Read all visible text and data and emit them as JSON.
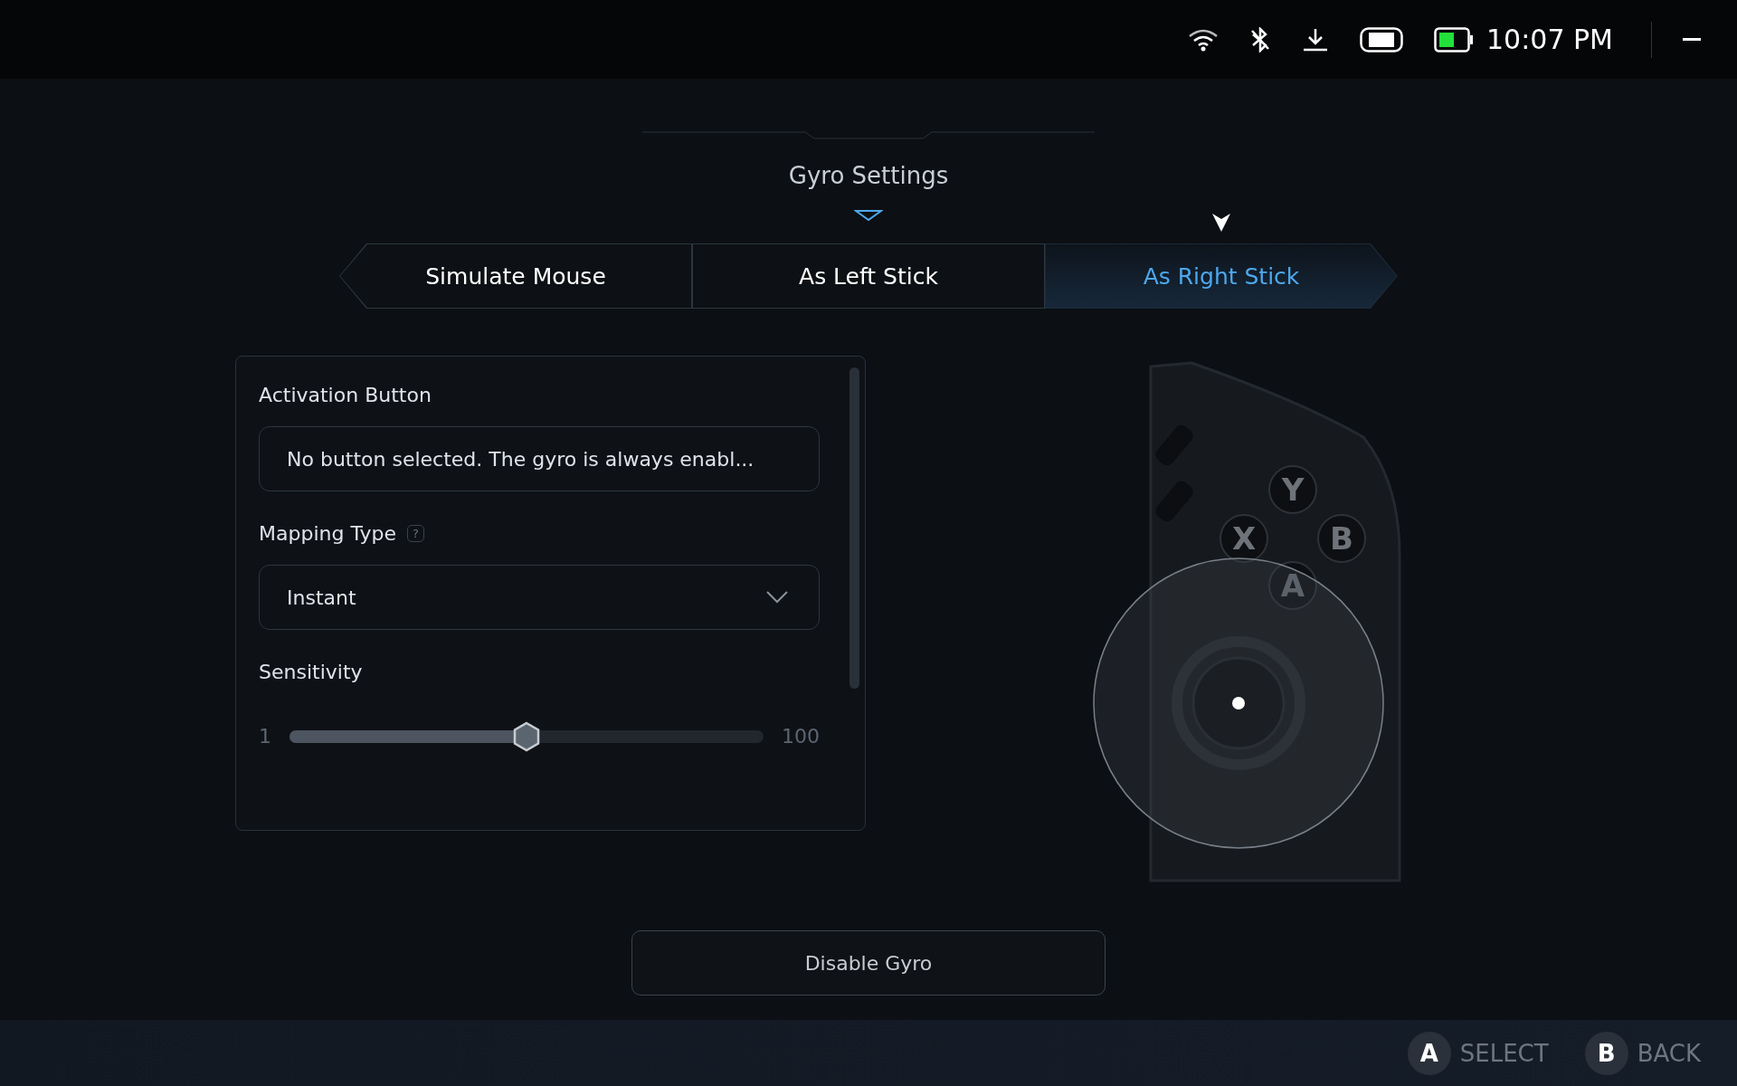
{
  "status_bar": {
    "time": "10:07 PM"
  },
  "header": {
    "title": "Gyro Settings"
  },
  "tabs": [
    {
      "label": "Simulate Mouse",
      "selected": false
    },
    {
      "label": "As Left Stick",
      "selected": false
    },
    {
      "label": "As Right Stick",
      "selected": true
    }
  ],
  "settings": {
    "activation": {
      "label": "Activation Button",
      "value": "No button selected. The gyro is always enabl..."
    },
    "mapping": {
      "label": "Mapping Type",
      "help": "?",
      "value": "Instant"
    },
    "sensitivity": {
      "label": "Sensitivity",
      "min": "1",
      "max": "100",
      "level": 0.5
    }
  },
  "controller": {
    "buttons": [
      "Y",
      "X",
      "B",
      "A"
    ]
  },
  "disable_button": "Disable Gyro",
  "footer": [
    {
      "key": "A",
      "label": "SELECT"
    },
    {
      "key": "B",
      "label": "BACK"
    }
  ]
}
